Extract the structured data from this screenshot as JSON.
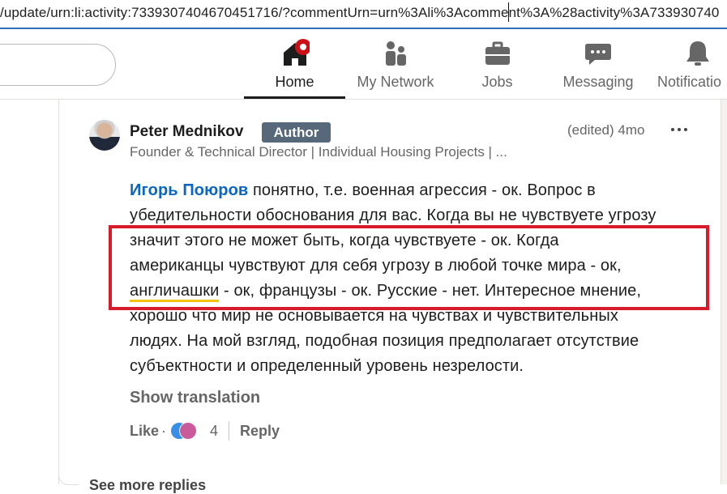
{
  "browser": {
    "url": "/update/urn:li:activity:7339307404670451716/?commentUrn=urn%3Ali%3Acomment%3A%28activity%3A733930740"
  },
  "topnav": {
    "items": [
      {
        "label": "Home",
        "icon": "home-icon"
      },
      {
        "label": "My Network",
        "icon": "people-icon"
      },
      {
        "label": "Jobs",
        "icon": "briefcase-icon"
      },
      {
        "label": "Messaging",
        "icon": "chat-icon"
      },
      {
        "label": "Notificatio",
        "icon": "bell-icon"
      }
    ],
    "active": "Home"
  },
  "comment": {
    "author": "Peter Mednikov",
    "badge": "Author",
    "time": "(edited) 4mo",
    "headline": "Founder & Technical Director | Individual Housing Projects | ...",
    "mention": "Игорь Поюров",
    "lines": [
      " понятно, т.е. военная агрессия - ок. Вопрос в",
      "убедительности обоснования для вас. Когда вы не чувствуете угрозу",
      "значит этого не может быть, когда чувствуете - ок. Когда",
      "американцы чувствуют для себя угрозу в любой точке мира - ок,",
      "англичашки",
      " - ок, французы - ок. Русские - нет. Интересное мнение,",
      "хорошо что мир не основывается на чувствах и чувствительных",
      "людях. На мой взгляд, подобная позиция предполагает отсутствие",
      "субъектности и определенный уровень незрелости."
    ],
    "show_translation": "Show translation",
    "actions": {
      "like": "Like",
      "dot": "·",
      "reaction_count": "4",
      "reply": "Reply"
    }
  },
  "footer": {
    "see_more": "See more replies"
  },
  "colors": {
    "link_blue": "#0a66c2",
    "badge_gray": "#56687a",
    "annotation_red": "#d81b2a",
    "highlight_yellow": "#f4c20d",
    "notification_red": "#cc1016"
  }
}
